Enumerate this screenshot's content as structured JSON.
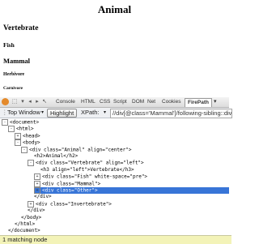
{
  "page": {
    "h1": "Animal",
    "h2": "Vertebrate",
    "h3": "Fish",
    "h2b": "Mammal",
    "h4": "Herbivore",
    "h5": "Carnivore"
  },
  "firebug": {
    "tabs": [
      "Console",
      "HTML",
      "CSS",
      "Script",
      "DOM",
      "Net",
      "Cookies",
      "FirePath"
    ],
    "active_tab": "FirePath",
    "toolbar": {
      "top_window": "Top Window",
      "highlight": "Highlight",
      "xpath_label": "XPath:",
      "xpath_value": "//div[@class='Mammal']/following-sibling::div"
    },
    "tree": [
      {
        "indent": 0,
        "exp": "-",
        "html": "<document>"
      },
      {
        "indent": 1,
        "exp": "-",
        "html": "<html>"
      },
      {
        "indent": 2,
        "exp": "+",
        "html": "<head>"
      },
      {
        "indent": 2,
        "exp": "-",
        "html": "<body>"
      },
      {
        "indent": 3,
        "exp": "-",
        "html": "<div class=\"Animal\" align=\"center\">"
      },
      {
        "indent": 4,
        "exp": "",
        "html": "<h2>Animal</h2>"
      },
      {
        "indent": 4,
        "exp": "-",
        "html": "<div class=\"Vertebrate\" align=\"left\">"
      },
      {
        "indent": 5,
        "exp": "",
        "html": "<h3 align=\"left\">Vertebrate</h3>"
      },
      {
        "indent": 5,
        "exp": "+",
        "html": "<div class=\"Fish\" white-space=\"pre\">"
      },
      {
        "indent": 5,
        "exp": "+",
        "html": "<div class=\"Mammal\">"
      },
      {
        "indent": 5,
        "exp": "+",
        "html": "<div class=\"Other\">",
        "selected": true
      },
      {
        "indent": 4,
        "exp": "",
        "html": "</div>"
      },
      {
        "indent": 4,
        "exp": "+",
        "html": "<div class=\"Invertebrate\">"
      },
      {
        "indent": 3,
        "exp": "",
        "html": "</div>"
      },
      {
        "indent": 2,
        "exp": "",
        "html": "</body>"
      },
      {
        "indent": 1,
        "exp": "",
        "html": "</html>"
      },
      {
        "indent": 0,
        "exp": "",
        "html": "</document>"
      }
    ],
    "status": "1 matching node"
  }
}
